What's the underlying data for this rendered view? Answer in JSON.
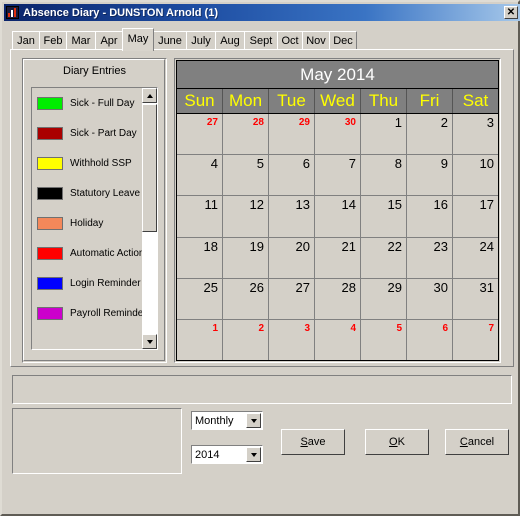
{
  "window": {
    "title": "Absence Diary - DUNSTON Arnold (1)",
    "app_icon": "bar-chart-icon",
    "close_label": "✕"
  },
  "tabs": {
    "items": [
      {
        "label": "Jan",
        "selected": false
      },
      {
        "label": "Feb",
        "selected": false
      },
      {
        "label": "Mar",
        "selected": false
      },
      {
        "label": "Apr",
        "selected": false
      },
      {
        "label": "May",
        "selected": true
      },
      {
        "label": "June",
        "selected": false
      },
      {
        "label": "July",
        "selected": false
      },
      {
        "label": "Aug",
        "selected": false
      },
      {
        "label": "Sept",
        "selected": false
      },
      {
        "label": "Oct",
        "selected": false
      },
      {
        "label": "Nov",
        "selected": false
      },
      {
        "label": "Dec",
        "selected": false
      }
    ]
  },
  "diary_entries": {
    "title": "Diary Entries",
    "items": [
      {
        "label": "Sick - Full Day",
        "color": "#00ee00"
      },
      {
        "label": "Sick - Part Day",
        "color": "#aa0000"
      },
      {
        "label": "Withhold SSP",
        "color": "#ffff00"
      },
      {
        "label": "Statutory Leave",
        "color": "#000000"
      },
      {
        "label": "Holiday",
        "color": "#f4885a"
      },
      {
        "label": "Automatic Action",
        "color": "#ff0000"
      },
      {
        "label": "Login Reminder",
        "color": "#0000ff"
      },
      {
        "label": "Payroll Reminder",
        "color": "#cc00cc"
      }
    ],
    "scrollbar": {
      "up_arrow": "scroll-up-icon",
      "down_arrow": "scroll-down-icon"
    }
  },
  "calendar": {
    "month_title": "May 2014",
    "day_headers": [
      "Sun",
      "Mon",
      "Tue",
      "Wed",
      "Thu",
      "Fri",
      "Sat"
    ],
    "weeks": [
      [
        {
          "day": "27",
          "other_month": true
        },
        {
          "day": "28",
          "other_month": true
        },
        {
          "day": "29",
          "other_month": true
        },
        {
          "day": "30",
          "other_month": true
        },
        {
          "day": "1",
          "other_month": false
        },
        {
          "day": "2",
          "other_month": false
        },
        {
          "day": "3",
          "other_month": false
        }
      ],
      [
        {
          "day": "4",
          "other_month": false
        },
        {
          "day": "5",
          "other_month": false
        },
        {
          "day": "6",
          "other_month": false
        },
        {
          "day": "7",
          "other_month": false
        },
        {
          "day": "8",
          "other_month": false
        },
        {
          "day": "9",
          "other_month": false
        },
        {
          "day": "10",
          "other_month": false
        }
      ],
      [
        {
          "day": "11",
          "other_month": false
        },
        {
          "day": "12",
          "other_month": false
        },
        {
          "day": "13",
          "other_month": false
        },
        {
          "day": "14",
          "other_month": false
        },
        {
          "day": "15",
          "other_month": false
        },
        {
          "day": "16",
          "other_month": false
        },
        {
          "day": "17",
          "other_month": false
        }
      ],
      [
        {
          "day": "18",
          "other_month": false
        },
        {
          "day": "19",
          "other_month": false
        },
        {
          "day": "20",
          "other_month": false
        },
        {
          "day": "21",
          "other_month": false
        },
        {
          "day": "22",
          "other_month": false
        },
        {
          "day": "23",
          "other_month": false
        },
        {
          "day": "24",
          "other_month": false
        }
      ],
      [
        {
          "day": "25",
          "other_month": false
        },
        {
          "day": "26",
          "other_month": false
        },
        {
          "day": "27",
          "other_month": false
        },
        {
          "day": "28",
          "other_month": false
        },
        {
          "day": "29",
          "other_month": false
        },
        {
          "day": "30",
          "other_month": false
        },
        {
          "day": "31",
          "other_month": false
        }
      ],
      [
        {
          "day": "1",
          "other_month": true
        },
        {
          "day": "2",
          "other_month": true
        },
        {
          "day": "3",
          "other_month": true
        },
        {
          "day": "4",
          "other_month": true
        },
        {
          "day": "5",
          "other_month": true
        },
        {
          "day": "6",
          "other_month": true
        },
        {
          "day": "7",
          "other_month": true
        }
      ]
    ],
    "colors": {
      "header_background": "#808080",
      "month_title_text": "#ffffff",
      "day_header_text": "#ffff00",
      "cell_background": "#d4d0c8",
      "current_month_text": "#000000",
      "other_month_text": "#ff0000"
    }
  },
  "bottom": {
    "status_panel_text": "",
    "notes_panel_text": "",
    "period_combo": {
      "value": "Monthly"
    },
    "year_combo": {
      "value": "2014"
    },
    "buttons": [
      {
        "name": "save-button",
        "pre": "",
        "accel": "S",
        "post": "ave"
      },
      {
        "name": "ok-button",
        "pre": "",
        "accel": "O",
        "post": "K"
      },
      {
        "name": "cancel-button",
        "pre": "",
        "accel": "C",
        "post": "ancel"
      }
    ]
  }
}
